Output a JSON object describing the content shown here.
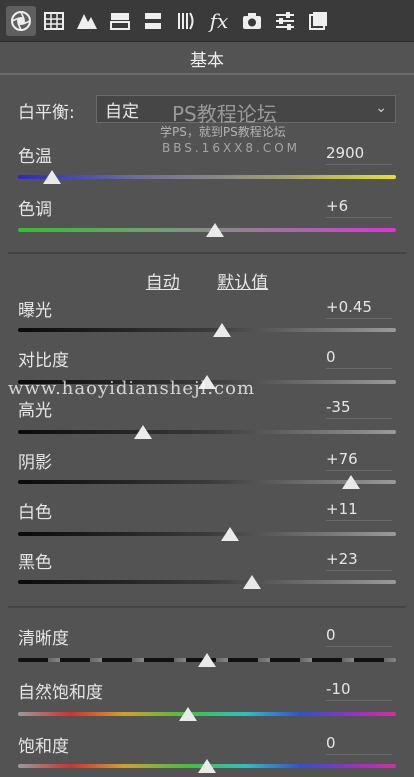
{
  "toolbar": {
    "icons": [
      "aperture-icon",
      "grid-icon",
      "mountains-icon",
      "split-toning-icon",
      "hsl-icon",
      "detail-icon",
      "fx-icon",
      "camera-icon",
      "sliders-icon",
      "presets-icon"
    ]
  },
  "panel_title": "基本",
  "white_balance": {
    "label": "白平衡:",
    "value": "自定"
  },
  "watermarks": {
    "ps_title": "PS教程论坛",
    "ps_sub": "学PS，就到PS教程论坛",
    "ps_url": "BBS.16XX8.COM",
    "site": "www.haoyidianshejl.com"
  },
  "sliders_wb": [
    {
      "label": "色温",
      "value": "2900",
      "position": 0.09,
      "gradient": "blue-yellow"
    },
    {
      "label": "色调",
      "value": "+6",
      "position": 0.52,
      "gradient": "green-magenta"
    }
  ],
  "links": {
    "auto": "自动",
    "default": "默认值"
  },
  "sliders_tone": [
    {
      "label": "曝光",
      "value": "+0.45",
      "position": 0.54
    },
    {
      "label": "对比度",
      "value": "0",
      "position": 0.5
    },
    {
      "label": "高光",
      "value": "-35",
      "position": 0.33
    },
    {
      "label": "阴影",
      "value": "+76",
      "position": 0.88
    },
    {
      "label": "白色",
      "value": "+11",
      "position": 0.56
    },
    {
      "label": "黑色",
      "value": "+23",
      "position": 0.62
    }
  ],
  "sliders_presence": [
    {
      "label": "清晰度",
      "value": "0",
      "position": 0.5,
      "gradient": "dark"
    },
    {
      "label": "自然饱和度",
      "value": "-10",
      "position": 0.45,
      "gradient": "rainbow"
    },
    {
      "label": "饱和度",
      "value": "0",
      "position": 0.5,
      "gradient": "rainbow"
    }
  ]
}
